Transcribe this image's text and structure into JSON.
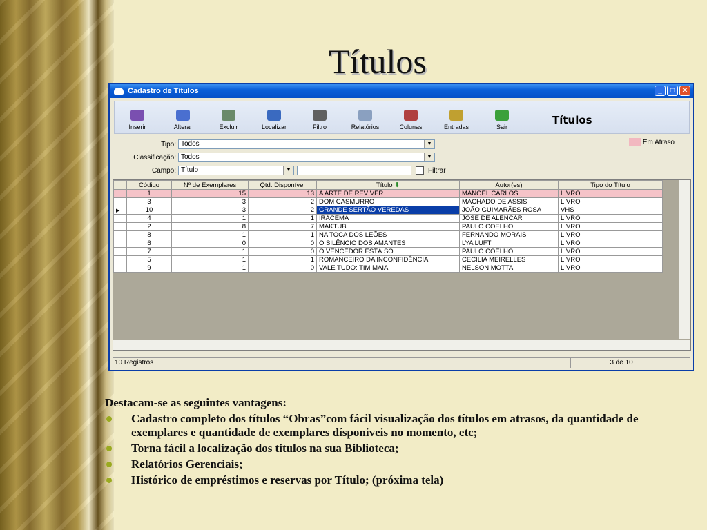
{
  "slide": {
    "title": "Títulos"
  },
  "window": {
    "title": "Cadastro de Títulos",
    "toolbar": {
      "buttons": [
        {
          "label": "Inserir",
          "icon": "insert-icon"
        },
        {
          "label": "Alterar",
          "icon": "edit-icon"
        },
        {
          "label": "Excluir",
          "icon": "delete-icon"
        },
        {
          "label": "Localizar",
          "icon": "find-icon"
        },
        {
          "label": "Filtro",
          "icon": "filter-icon"
        },
        {
          "label": "Relatórios",
          "icon": "printer-icon"
        },
        {
          "label": "Colunas",
          "icon": "columns-icon"
        },
        {
          "label": "Entradas",
          "icon": "entries-icon"
        },
        {
          "label": "Sair",
          "icon": "check-icon"
        }
      ],
      "heading": "Títulos"
    },
    "filters": {
      "tipo_label": "Tipo:",
      "tipo_value": "Todos",
      "classificacao_label": "Classificação:",
      "classificacao_value": "Todos",
      "campo_label": "Campo:",
      "campo_value": "Título",
      "filtrar_label": "Filtrar",
      "legend_label": "Em Atraso"
    },
    "grid": {
      "columns": [
        "Código",
        "Nº de Exemplares",
        "Qtd. Disponível",
        "Título",
        "Autor(es)",
        "Tipo do Título"
      ],
      "rows": [
        {
          "codigo": "1",
          "exemplares": "15",
          "disponivel": "13",
          "titulo": "A ARTE DE REVIVER",
          "autor": "MANOEL CARLOS",
          "tipo": "LIVRO",
          "late": true
        },
        {
          "codigo": "3",
          "exemplares": "3",
          "disponivel": "2",
          "titulo": "DOM CASMURRO",
          "autor": "MACHADO DE ASSIS",
          "tipo": "LIVRO"
        },
        {
          "codigo": "10",
          "exemplares": "3",
          "disponivel": "2",
          "titulo": "GRANDE SERTÃO VEREDAS",
          "autor": "JOÃO GUIMARÃES ROSA",
          "tipo": "VHS",
          "selected": true
        },
        {
          "codigo": "4",
          "exemplares": "1",
          "disponivel": "1",
          "titulo": "IRACEMA",
          "autor": "JOSÉ DE ALENCAR",
          "tipo": "LIVRO"
        },
        {
          "codigo": "2",
          "exemplares": "8",
          "disponivel": "7",
          "titulo": "MAKTUB",
          "autor": "PAULO COELHO",
          "tipo": "LIVRO"
        },
        {
          "codigo": "8",
          "exemplares": "1",
          "disponivel": "1",
          "titulo": "NA TOCA DOS LEÕES",
          "autor": "FERNANDO MORAIS",
          "tipo": "LIVRO"
        },
        {
          "codigo": "6",
          "exemplares": "0",
          "disponivel": "0",
          "titulo": "O SILÊNCIO DOS AMANTES",
          "autor": "LYA LUFT",
          "tipo": "LIVRO"
        },
        {
          "codigo": "7",
          "exemplares": "1",
          "disponivel": "0",
          "titulo": "O VENCEDOR ESTÁ SÓ",
          "autor": "PAULO COELHO",
          "tipo": "LIVRO"
        },
        {
          "codigo": "5",
          "exemplares": "1",
          "disponivel": "1",
          "titulo": "ROMANCEIRO DA INCONFIDÊNCIA",
          "autor": "CECILIA MEIRELLES",
          "tipo": "LIVRO"
        },
        {
          "codigo": "9",
          "exemplares": "1",
          "disponivel": "0",
          "titulo": "VALE TUDO: TIM MAIA",
          "autor": "NELSON MOTTA",
          "tipo": "LIVRO"
        }
      ]
    },
    "status": {
      "records": "10 Registros",
      "position": "3 de 10"
    }
  },
  "notes": {
    "intro": "Destacam-se as seguintes vantagens:",
    "items": [
      "Cadastro completo dos títulos “Obras”com fácil visualização dos títulos em atrasos, da quantidade de exemplares e quantidade de exemplares dísponiveis no momento, etc;",
      "Torna fácil a localização dos titulos na sua Biblioteca;",
      "Relatórios Gerenciais;",
      "Histórico de empréstimos e reservas por Título; (próxima tela)"
    ]
  },
  "colors": {
    "accent": "#0a3ea8",
    "late_row": "#f5c3c8",
    "bullet": "#9aaa20"
  }
}
